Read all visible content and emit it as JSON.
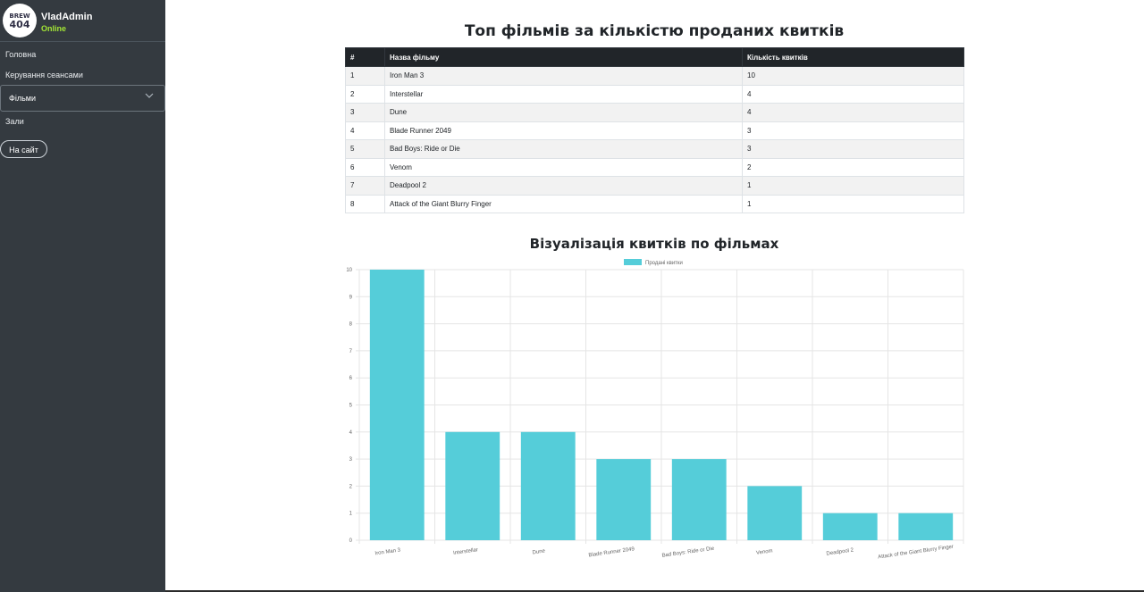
{
  "sidebar": {
    "logo_text_top": "BREW",
    "logo_text_bottom": "404",
    "user_name": "VladAdmin",
    "user_status": "Online",
    "nav": [
      "Головна",
      "Керування сеансами",
      "Фільми",
      "Зали"
    ],
    "site_button": "На сайт",
    "icons": {
      "expand": "chevron-down-icon"
    }
  },
  "main": {
    "table_title": "Топ фільмів за кількістю проданих квитків",
    "chart_title": "Візуалізація квитків по фільмах",
    "table": {
      "headers": [
        "#",
        "Назва фільму",
        "Кількість квитків"
      ],
      "rows": [
        [
          "1",
          "Iron Man 3",
          "10"
        ],
        [
          "2",
          "Interstellar",
          "4"
        ],
        [
          "3",
          "Dune",
          "4"
        ],
        [
          "4",
          "Blade Runner 2049",
          "3"
        ],
        [
          "5",
          "Bad Boys: Ride or Die",
          "3"
        ],
        [
          "6",
          "Venom",
          "2"
        ],
        [
          "7",
          "Deadpool 2",
          "1"
        ],
        [
          "8",
          "Attack of the Giant Blurry Finger",
          "1"
        ]
      ]
    }
  },
  "colors": {
    "sidebar_bg": "#343a40",
    "status_online": "#a3e635",
    "bar_fill": "#55cdd9",
    "table_header_bg": "#212529"
  },
  "chart_data": {
    "type": "bar",
    "categories": [
      "Iron Man 3",
      "Interstellar",
      "Dune",
      "Blade Runner 2049",
      "Bad Boys: Ride or Die",
      "Venom",
      "Deadpool 2",
      "Attack of the Giant Blurry Finger"
    ],
    "series": [
      {
        "name": "Продані квитки",
        "values": [
          10,
          4,
          4,
          3,
          3,
          2,
          1,
          1
        ]
      }
    ],
    "ylim": [
      0,
      10
    ],
    "yticks": [
      0,
      1,
      2,
      3,
      4,
      5,
      6,
      7,
      8,
      9,
      10
    ],
    "legend": "top",
    "grid": true
  }
}
